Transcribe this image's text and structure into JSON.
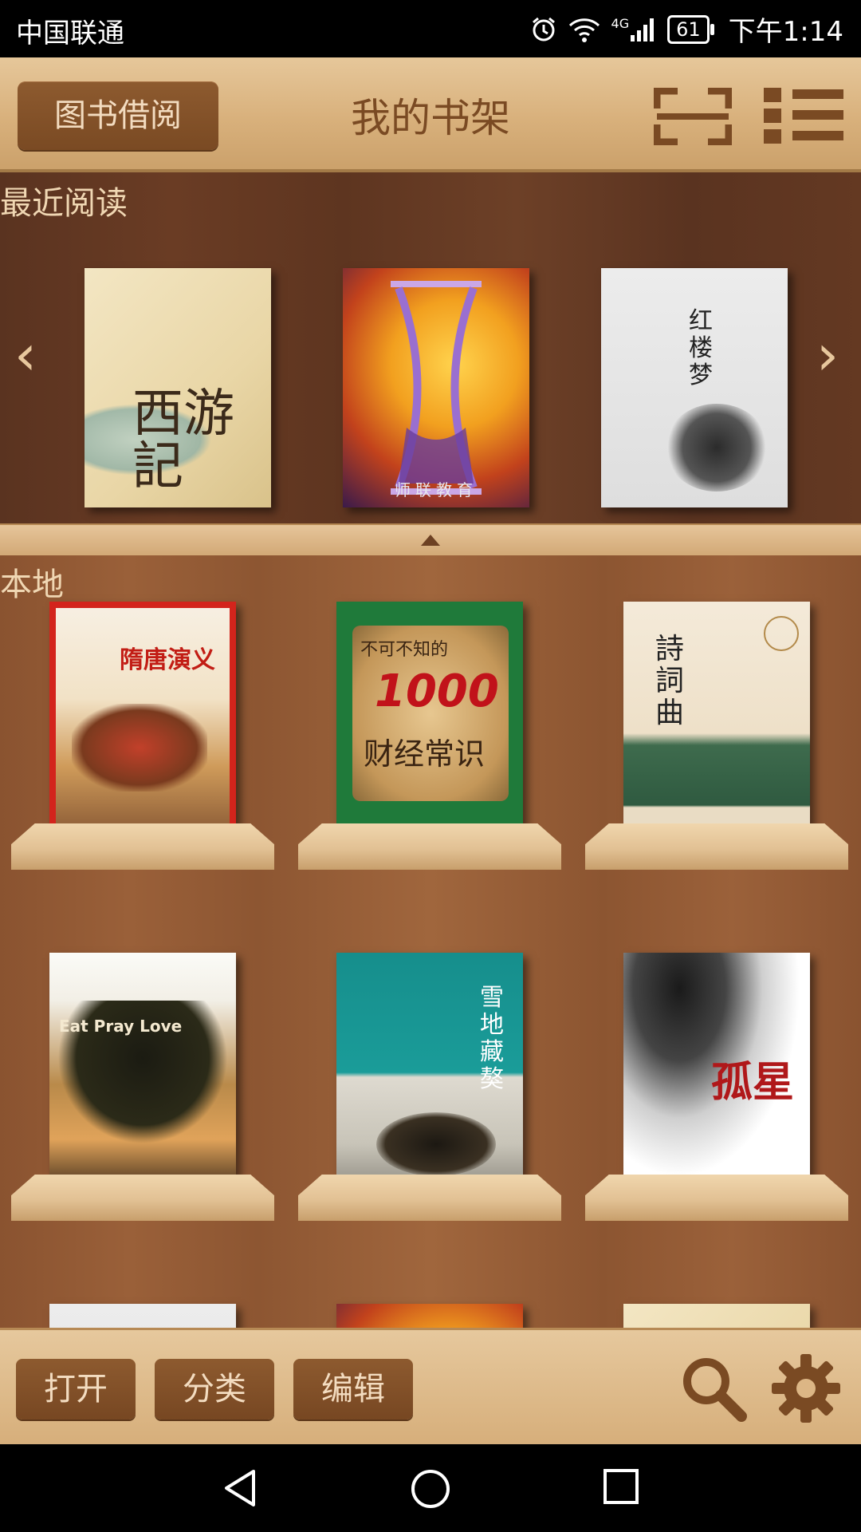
{
  "status_bar": {
    "carrier": "中国联通",
    "network": "4G",
    "battery": "61",
    "time": "下午1:14"
  },
  "header": {
    "borrow_button": "图书借阅",
    "title": "我的书架"
  },
  "recent": {
    "label": "最近阅读",
    "prev": "‹",
    "next": "›",
    "books": [
      {
        "title_art": "西游記"
      },
      {
        "title_art": "师联教育"
      },
      {
        "title_art": "红楼梦"
      }
    ]
  },
  "local": {
    "label": "本地",
    "books": [
      {
        "cover_text": "隋唐演义"
      },
      {
        "cover_text": "1000",
        "subtitle": "财经常识",
        "top": "不可不知的"
      },
      {
        "cover_text": "詩詞曲"
      },
      {
        "cover_text": "Eat Pray Love"
      },
      {
        "cover_text": "雪地藏獒"
      },
      {
        "cover_text": "孤星"
      }
    ]
  },
  "toolbar": {
    "open": "打开",
    "category": "分类",
    "edit": "编辑"
  },
  "colors": {
    "accent_brown": "#7a4a23",
    "header_wood": "#d8b07b",
    "shelf_dark": "#5e3520"
  }
}
